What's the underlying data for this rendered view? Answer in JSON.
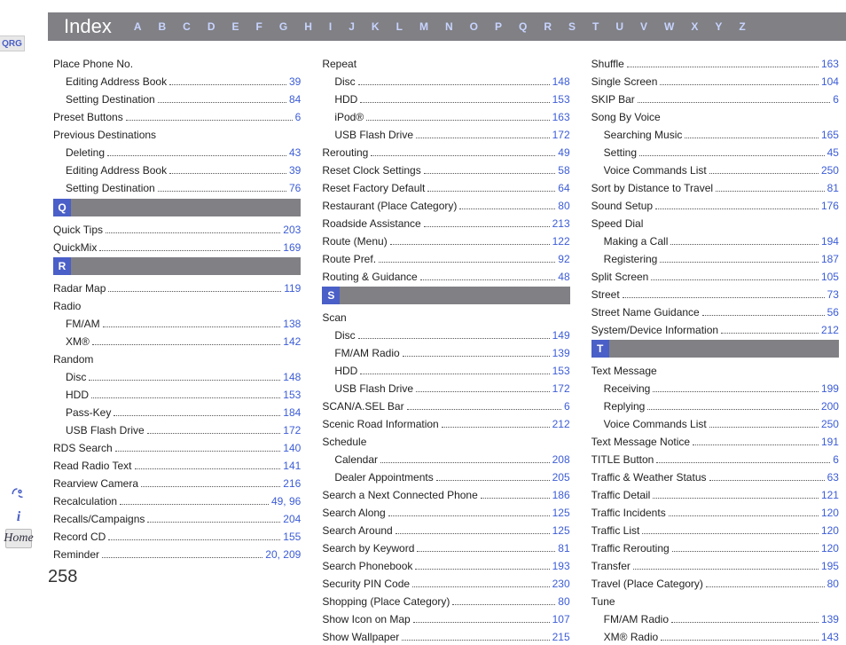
{
  "header": {
    "title": "Index",
    "letters": [
      "A",
      "B",
      "C",
      "D",
      "E",
      "F",
      "G",
      "H",
      "I",
      "J",
      "K",
      "L",
      "M",
      "N",
      "O",
      "P",
      "Q",
      "R",
      "S",
      "T",
      "U",
      "V",
      "W",
      "X",
      "Y",
      "Z"
    ]
  },
  "sidebar": {
    "qrg_label": "QRG",
    "info_label": "i",
    "home_label": "Home"
  },
  "page_number": "258",
  "columns": [
    {
      "groups": [
        {
          "entries": [
            {
              "label": "Place Phone No.",
              "page": "",
              "sub": 0
            },
            {
              "label": "Editing Address Book",
              "page": "39",
              "sub": 1
            },
            {
              "label": "Setting Destination",
              "page": "84",
              "sub": 1
            },
            {
              "label": "Preset Buttons",
              "page": "6",
              "sub": 0
            },
            {
              "label": "Previous Destinations",
              "page": "",
              "sub": 0
            },
            {
              "label": "Deleting",
              "page": "43",
              "sub": 1
            },
            {
              "label": "Editing Address Book",
              "page": "39",
              "sub": 1
            },
            {
              "label": "Setting Destination",
              "page": "76",
              "sub": 1
            }
          ]
        },
        {
          "head": "Q",
          "entries": [
            {
              "label": "Quick Tips",
              "page": "203",
              "sub": 0
            },
            {
              "label": "QuickMix",
              "page": "169",
              "sub": 0
            }
          ]
        },
        {
          "head": "R",
          "entries": [
            {
              "label": "Radar Map",
              "page": "119",
              "sub": 0
            },
            {
              "label": "Radio",
              "page": "",
              "sub": 0
            },
            {
              "label": "FM/AM",
              "page": "138",
              "sub": 1
            },
            {
              "label": "XM®",
              "page": "142",
              "sub": 1
            },
            {
              "label": "Random",
              "page": "",
              "sub": 0
            },
            {
              "label": "Disc",
              "page": "148",
              "sub": 1
            },
            {
              "label": "HDD",
              "page": "153",
              "sub": 1
            },
            {
              "label": "Pass-Key",
              "page": "184",
              "sub": 1
            },
            {
              "label": "USB Flash Drive",
              "page": "172",
              "sub": 1
            },
            {
              "label": "RDS Search",
              "page": "140",
              "sub": 0
            },
            {
              "label": "Read Radio Text",
              "page": "141",
              "sub": 0
            },
            {
              "label": "Rearview Camera",
              "page": "216",
              "sub": 0
            },
            {
              "label": "Recalculation",
              "page": "49, 96",
              "sub": 0
            },
            {
              "label": "Recalls/Campaigns",
              "page": "204",
              "sub": 0
            },
            {
              "label": "Record CD",
              "page": "155",
              "sub": 0
            },
            {
              "label": "Reminder",
              "page": "20, 209",
              "sub": 0
            }
          ]
        }
      ]
    },
    {
      "groups": [
        {
          "entries": [
            {
              "label": "Repeat",
              "page": "",
              "sub": 0
            },
            {
              "label": "Disc",
              "page": "148",
              "sub": 1
            },
            {
              "label": "HDD",
              "page": "153",
              "sub": 1
            },
            {
              "label": "iPod®",
              "page": "163",
              "sub": 1
            },
            {
              "label": "USB Flash Drive",
              "page": "172",
              "sub": 1
            },
            {
              "label": "Rerouting",
              "page": "49",
              "sub": 0
            },
            {
              "label": "Reset Clock Settings",
              "page": "58",
              "sub": 0
            },
            {
              "label": "Reset Factory Default",
              "page": "64",
              "sub": 0
            },
            {
              "label": "Restaurant (Place Category)",
              "page": "80",
              "sub": 0
            },
            {
              "label": "Roadside Assistance",
              "page": "213",
              "sub": 0
            },
            {
              "label": "Route (Menu)",
              "page": "122",
              "sub": 0
            },
            {
              "label": "Route Pref.",
              "page": "92",
              "sub": 0
            },
            {
              "label": "Routing & Guidance",
              "page": "48",
              "sub": 0
            }
          ]
        },
        {
          "head": "S",
          "entries": [
            {
              "label": "Scan",
              "page": "",
              "sub": 0
            },
            {
              "label": "Disc",
              "page": "149",
              "sub": 1
            },
            {
              "label": "FM/AM Radio",
              "page": "139",
              "sub": 1
            },
            {
              "label": "HDD",
              "page": "153",
              "sub": 1
            },
            {
              "label": "USB Flash Drive",
              "page": "172",
              "sub": 1
            },
            {
              "label": "SCAN/A.SEL Bar",
              "page": "6",
              "sub": 0
            },
            {
              "label": "Scenic Road Information",
              "page": "212",
              "sub": 0
            },
            {
              "label": "Schedule",
              "page": "",
              "sub": 0
            },
            {
              "label": "Calendar",
              "page": "208",
              "sub": 1
            },
            {
              "label": "Dealer Appointments",
              "page": "205",
              "sub": 1
            },
            {
              "label": "Search a Next Connected Phone",
              "page": "186",
              "sub": 0
            },
            {
              "label": "Search Along",
              "page": "125",
              "sub": 0
            },
            {
              "label": "Search Around",
              "page": "125",
              "sub": 0
            },
            {
              "label": "Search by Keyword",
              "page": "81",
              "sub": 0
            },
            {
              "label": "Search Phonebook",
              "page": "193",
              "sub": 0
            },
            {
              "label": "Security PIN Code",
              "page": "230",
              "sub": 0
            },
            {
              "label": "Shopping (Place Category)",
              "page": "80",
              "sub": 0
            },
            {
              "label": "Show Icon on Map",
              "page": "107",
              "sub": 0
            },
            {
              "label": "Show Wallpaper",
              "page": "215",
              "sub": 0
            }
          ]
        }
      ]
    },
    {
      "groups": [
        {
          "entries": [
            {
              "label": "Shuffle",
              "page": "163",
              "sub": 0
            },
            {
              "label": "Single Screen",
              "page": "104",
              "sub": 0
            },
            {
              "label": "SKIP Bar",
              "page": "6",
              "sub": 0
            },
            {
              "label": "Song By Voice",
              "page": "",
              "sub": 0
            },
            {
              "label": "Searching Music",
              "page": "165",
              "sub": 1
            },
            {
              "label": "Setting",
              "page": "45",
              "sub": 1
            },
            {
              "label": "Voice Commands List",
              "page": "250",
              "sub": 1
            },
            {
              "label": "Sort by Distance to Travel",
              "page": "81",
              "sub": 0
            },
            {
              "label": "Sound Setup",
              "page": "176",
              "sub": 0
            },
            {
              "label": "Speed Dial",
              "page": "",
              "sub": 0
            },
            {
              "label": "Making a Call",
              "page": "194",
              "sub": 1
            },
            {
              "label": "Registering",
              "page": "187",
              "sub": 1
            },
            {
              "label": "Split Screen",
              "page": "105",
              "sub": 0
            },
            {
              "label": "Street",
              "page": "73",
              "sub": 0
            },
            {
              "label": "Street Name Guidance",
              "page": "56",
              "sub": 0
            },
            {
              "label": "System/Device Information",
              "page": "212",
              "sub": 0
            }
          ]
        },
        {
          "head": "T",
          "entries": [
            {
              "label": "Text Message",
              "page": "",
              "sub": 0
            },
            {
              "label": "Receiving",
              "page": "199",
              "sub": 1
            },
            {
              "label": "Replying",
              "page": "200",
              "sub": 1
            },
            {
              "label": "Voice Commands List",
              "page": "250",
              "sub": 1
            },
            {
              "label": "Text Message Notice",
              "page": "191",
              "sub": 0
            },
            {
              "label": "TITLE Button",
              "page": "6",
              "sub": 0
            },
            {
              "label": "Traffic & Weather Status",
              "page": "63",
              "sub": 0
            },
            {
              "label": "Traffic Detail",
              "page": "121",
              "sub": 0
            },
            {
              "label": "Traffic Incidents",
              "page": "120",
              "sub": 0
            },
            {
              "label": "Traffic List",
              "page": "120",
              "sub": 0
            },
            {
              "label": "Traffic Rerouting",
              "page": "120",
              "sub": 0
            },
            {
              "label": "Transfer",
              "page": "195",
              "sub": 0
            },
            {
              "label": "Travel (Place Category)",
              "page": "80",
              "sub": 0
            },
            {
              "label": "Tune",
              "page": "",
              "sub": 0
            },
            {
              "label": "FM/AM Radio",
              "page": "139",
              "sub": 1
            },
            {
              "label": "XM® Radio",
              "page": "143",
              "sub": 1
            }
          ]
        }
      ]
    }
  ]
}
